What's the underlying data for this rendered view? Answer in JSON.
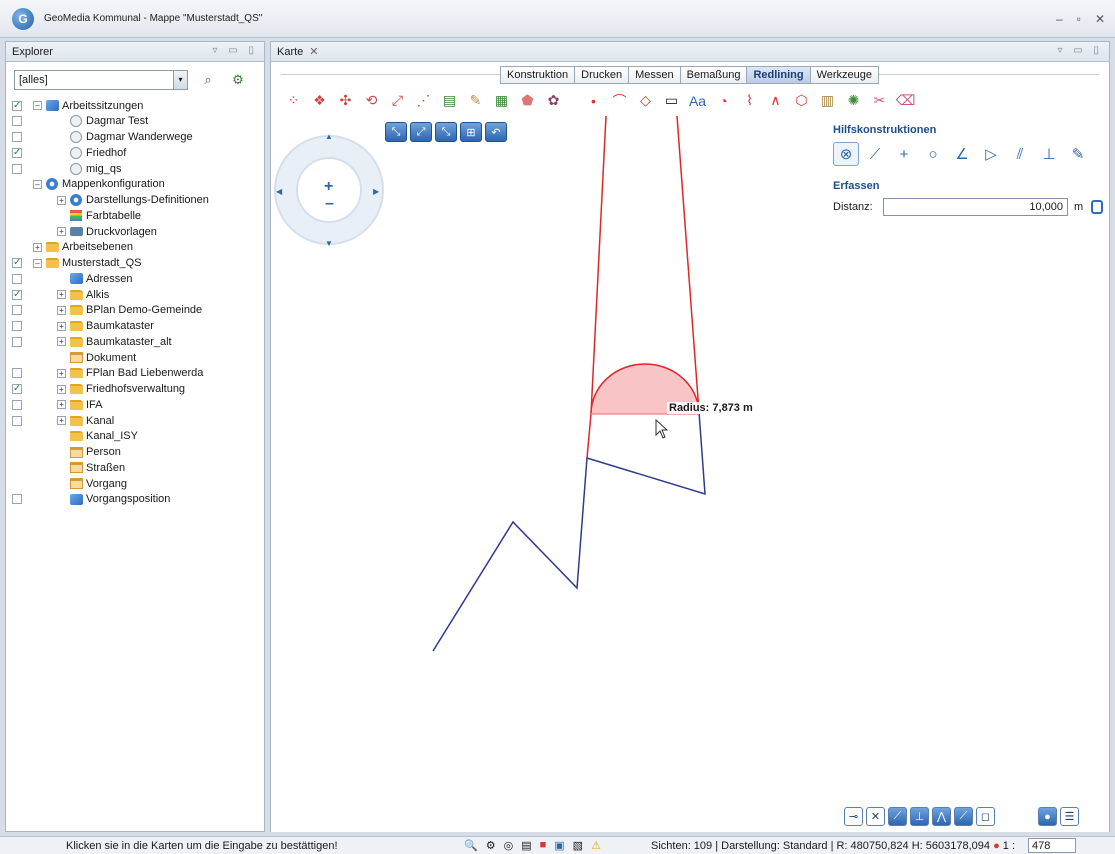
{
  "window": {
    "title": "GeoMedia Kommunal - Mappe \"Musterstadt_QS\"",
    "logo_letter": "G"
  },
  "explorer": {
    "tab_label": "Explorer",
    "filter_value": "[alles]",
    "tree": [
      {
        "label": "Arbeitssitzungen",
        "checked": true,
        "expander": "minus",
        "icon": "feature",
        "indent": 0
      },
      {
        "label": "Dagmar Test",
        "checked": false,
        "expander": "",
        "icon": "clock",
        "indent": 1
      },
      {
        "label": "Dagmar Wanderwege",
        "checked": false,
        "expander": "",
        "icon": "clock",
        "indent": 1
      },
      {
        "label": "Friedhof",
        "checked": true,
        "expander": "",
        "icon": "clock",
        "indent": 1
      },
      {
        "label": "mig_qs",
        "checked": false,
        "expander": "",
        "icon": "clock",
        "indent": 1
      },
      {
        "label": "Mappenkonfiguration",
        "checked": null,
        "expander": "minus",
        "icon": "gear",
        "indent": 0
      },
      {
        "label": "Darstellungs-Definitionen",
        "checked": null,
        "expander": "plus",
        "icon": "gear",
        "indent": 1
      },
      {
        "label": "Farbtabelle",
        "checked": null,
        "expander": "",
        "icon": "table",
        "indent": 1
      },
      {
        "label": "Druckvorlagen",
        "checked": null,
        "expander": "plus",
        "icon": "print",
        "indent": 1
      },
      {
        "label": "Arbeitsebenen",
        "checked": null,
        "expander": "plus",
        "icon": "folder",
        "indent": 0
      },
      {
        "label": "Musterstadt_QS",
        "checked": true,
        "expander": "minus",
        "icon": "folder",
        "indent": 0
      },
      {
        "label": "Adressen",
        "checked": false,
        "expander": "",
        "icon": "feature",
        "indent": 1
      },
      {
        "label": "Alkis",
        "checked": true,
        "expander": "plus",
        "icon": "folder",
        "indent": 1
      },
      {
        "label": "BPlan Demo-Gemeinde",
        "checked": false,
        "expander": "plus",
        "icon": "folder",
        "indent": 1
      },
      {
        "label": "Baumkataster",
        "checked": false,
        "expander": "plus",
        "icon": "folder",
        "indent": 1
      },
      {
        "label": "Baumkataster_alt",
        "checked": false,
        "expander": "plus",
        "icon": "folder",
        "indent": 1
      },
      {
        "label": "Dokument",
        "checked": null,
        "expander": "",
        "icon": "tablefile",
        "indent": 1
      },
      {
        "label": "FPlan Bad Liebenwerda",
        "checked": false,
        "expander": "plus",
        "icon": "folder",
        "indent": 1
      },
      {
        "label": "Friedhofsverwaltung",
        "checked": true,
        "expander": "plus",
        "icon": "folder",
        "indent": 1
      },
      {
        "label": "IFA",
        "checked": false,
        "expander": "plus",
        "icon": "folder",
        "indent": 1
      },
      {
        "label": "Kanal",
        "checked": false,
        "expander": "plus",
        "icon": "folder",
        "indent": 1
      },
      {
        "label": "Kanal_ISY",
        "checked": null,
        "expander": "",
        "icon": "folder",
        "indent": 1
      },
      {
        "label": "Person",
        "checked": null,
        "expander": "",
        "icon": "tablefile",
        "indent": 1
      },
      {
        "label": "Straßen",
        "checked": null,
        "expander": "",
        "icon": "tablefile",
        "indent": 1
      },
      {
        "label": "Vorgang",
        "checked": null,
        "expander": "",
        "icon": "tablefile",
        "indent": 1
      },
      {
        "label": "Vorgangsposition",
        "checked": false,
        "expander": "",
        "icon": "feature",
        "indent": 1
      }
    ]
  },
  "karte": {
    "tab_label": "Karte",
    "ribbon_tabs": [
      {
        "label": "Konstruktion",
        "active": false
      },
      {
        "label": "Drucken",
        "active": false
      },
      {
        "label": "Messen",
        "active": false
      },
      {
        "label": "Bemaßung",
        "active": false
      },
      {
        "label": "Redlining",
        "active": true
      },
      {
        "label": "Werkzeuge",
        "active": false
      }
    ],
    "radius_label": "Radius: 7,873 m",
    "hilfskonstruktionen_title": "Hilfskonstruktionen",
    "erfassen_title": "Erfassen",
    "distanz_label": "Distanz:",
    "distanz_value": "10,000",
    "distanz_unit": "m"
  },
  "status": {
    "message": "Klicken sie in die Karten um die Eingabe zu bestättigen!",
    "info": "Sichten: 109 | Darstellung: Standard | R: 480750,824  H: 5603178,094",
    "scale_prefix": "1 :",
    "scale_value": "478"
  },
  "colors": {
    "red_line": "#e0262a",
    "blue_line": "#2f3a8f",
    "arc_fill": "#f8c4c6",
    "accent": "#1b4f8a"
  }
}
